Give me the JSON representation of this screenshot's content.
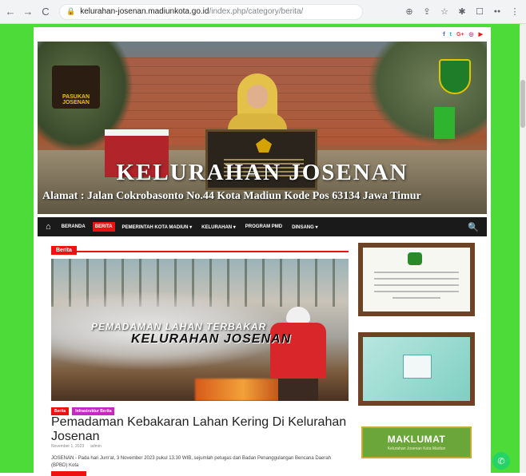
{
  "browser": {
    "back": "←",
    "forward": "→",
    "reload": "C",
    "lock": "🔒",
    "url_domain": "kelurahan-josenan.madiunkota.go.id",
    "url_path": "/index.php/category/berita/",
    "icons": [
      "translate-icon",
      "share-icon",
      "star-icon",
      "extensions-icon",
      "window-icon",
      "profile-icon",
      "menu-icon"
    ]
  },
  "social": {
    "facebook": "f",
    "twitter": "t",
    "google": "G+",
    "instagram": "◎",
    "youtube": "▶"
  },
  "header": {
    "logo_left_text": "PASUKAN JOSENAN",
    "title": "KELURAHAN JOSENAN",
    "address": "Alamat : Jalan Cokrobasonto No.44 Kota Madiun Kode Pos 63134 Jawa Timur"
  },
  "nav": {
    "home_icon": "⌂",
    "items": [
      "BERANDA",
      "BERITA",
      "PEMERINTAH KOTA MADIUN ▾",
      "KELURAHAN ▾",
      "PROGRAM PMD",
      "DINSANG ▾"
    ],
    "search_icon": "🔍"
  },
  "main": {
    "category": "Berita",
    "hero_caption_1": "PEMADAMAN LAHAN TERBAKAR",
    "hero_caption_2": "KELURAHAN JOSENAN",
    "tags": [
      "Berita",
      "Infrastruktur Berita"
    ],
    "post_title": "Pemadaman Kebakaran Lahan Kering Di Kelurahan Josenan",
    "meta_date": "November 1, 2023",
    "meta_author": "admin",
    "excerpt": "JOSENAN - Pada hari Jum'at, 3 November 2023 pukul 13.30 WIB, sejumlah petugas dari Badan Penanggulangan Bencana Daerah (BPBD) Kota"
  },
  "sidebar": {
    "maklumat_title": "MAKLUMAT",
    "maklumat_sub": "Kelurahan Josenan Kota Madiun"
  },
  "whatsapp_icon": "✆"
}
